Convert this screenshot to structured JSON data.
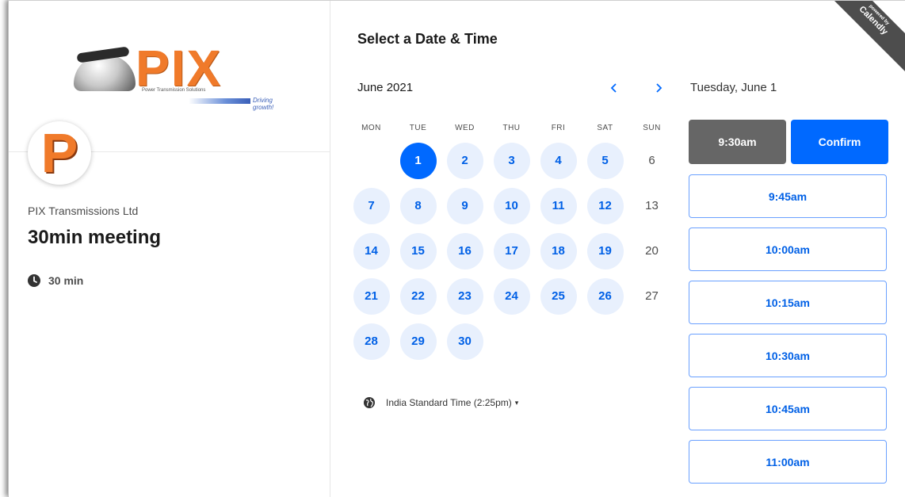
{
  "brand": {
    "logo_text": "PIX",
    "logo_tagline": "Power Transmission Solutions",
    "logo_slogan": "Driving growth!",
    "avatar_letter": "P",
    "accent": "#f07a2a"
  },
  "event": {
    "organization": "PIX Transmissions Ltd",
    "title": "30min meeting",
    "duration": "30 min",
    "duration_icon": "clock-icon"
  },
  "calendar": {
    "heading": "Select a Date & Time",
    "month_label": "June 2021",
    "prev_icon": "chevron-left-icon",
    "next_icon": "chevron-right-icon",
    "weekdays": [
      "MON",
      "TUE",
      "WED",
      "THU",
      "FRI",
      "SAT",
      "SUN"
    ],
    "leading_blanks": 1,
    "days": [
      {
        "n": "1",
        "state": "selected"
      },
      {
        "n": "2",
        "state": "available"
      },
      {
        "n": "3",
        "state": "available"
      },
      {
        "n": "4",
        "state": "available"
      },
      {
        "n": "5",
        "state": "available"
      },
      {
        "n": "6",
        "state": "disabled"
      },
      {
        "n": "7",
        "state": "available"
      },
      {
        "n": "8",
        "state": "available"
      },
      {
        "n": "9",
        "state": "available"
      },
      {
        "n": "10",
        "state": "available"
      },
      {
        "n": "11",
        "state": "available"
      },
      {
        "n": "12",
        "state": "available"
      },
      {
        "n": "13",
        "state": "disabled"
      },
      {
        "n": "14",
        "state": "available"
      },
      {
        "n": "15",
        "state": "available"
      },
      {
        "n": "16",
        "state": "available"
      },
      {
        "n": "17",
        "state": "available"
      },
      {
        "n": "18",
        "state": "available"
      },
      {
        "n": "19",
        "state": "available"
      },
      {
        "n": "20",
        "state": "disabled"
      },
      {
        "n": "21",
        "state": "available"
      },
      {
        "n": "22",
        "state": "available"
      },
      {
        "n": "23",
        "state": "available"
      },
      {
        "n": "24",
        "state": "available"
      },
      {
        "n": "25",
        "state": "available"
      },
      {
        "n": "26",
        "state": "available"
      },
      {
        "n": "27",
        "state": "disabled"
      },
      {
        "n": "28",
        "state": "available"
      },
      {
        "n": "29",
        "state": "available"
      },
      {
        "n": "30",
        "state": "available"
      }
    ],
    "timezone_label": "India Standard Time (2:25pm)",
    "timezone_icon": "globe-icon",
    "colors": {
      "available_bg": "#e8f0fd",
      "available_fg": "#0060e6",
      "selected_bg": "#0069ff"
    }
  },
  "times": {
    "selected_date": "Tuesday, June 1",
    "selected_time": "9:30am",
    "confirm_label": "Confirm",
    "slots": [
      "9:45am",
      "10:00am",
      "10:15am",
      "10:30am",
      "10:45am",
      "11:00am"
    ]
  },
  "ribbon": {
    "small_text": "powered by",
    "text": "Calendly"
  }
}
